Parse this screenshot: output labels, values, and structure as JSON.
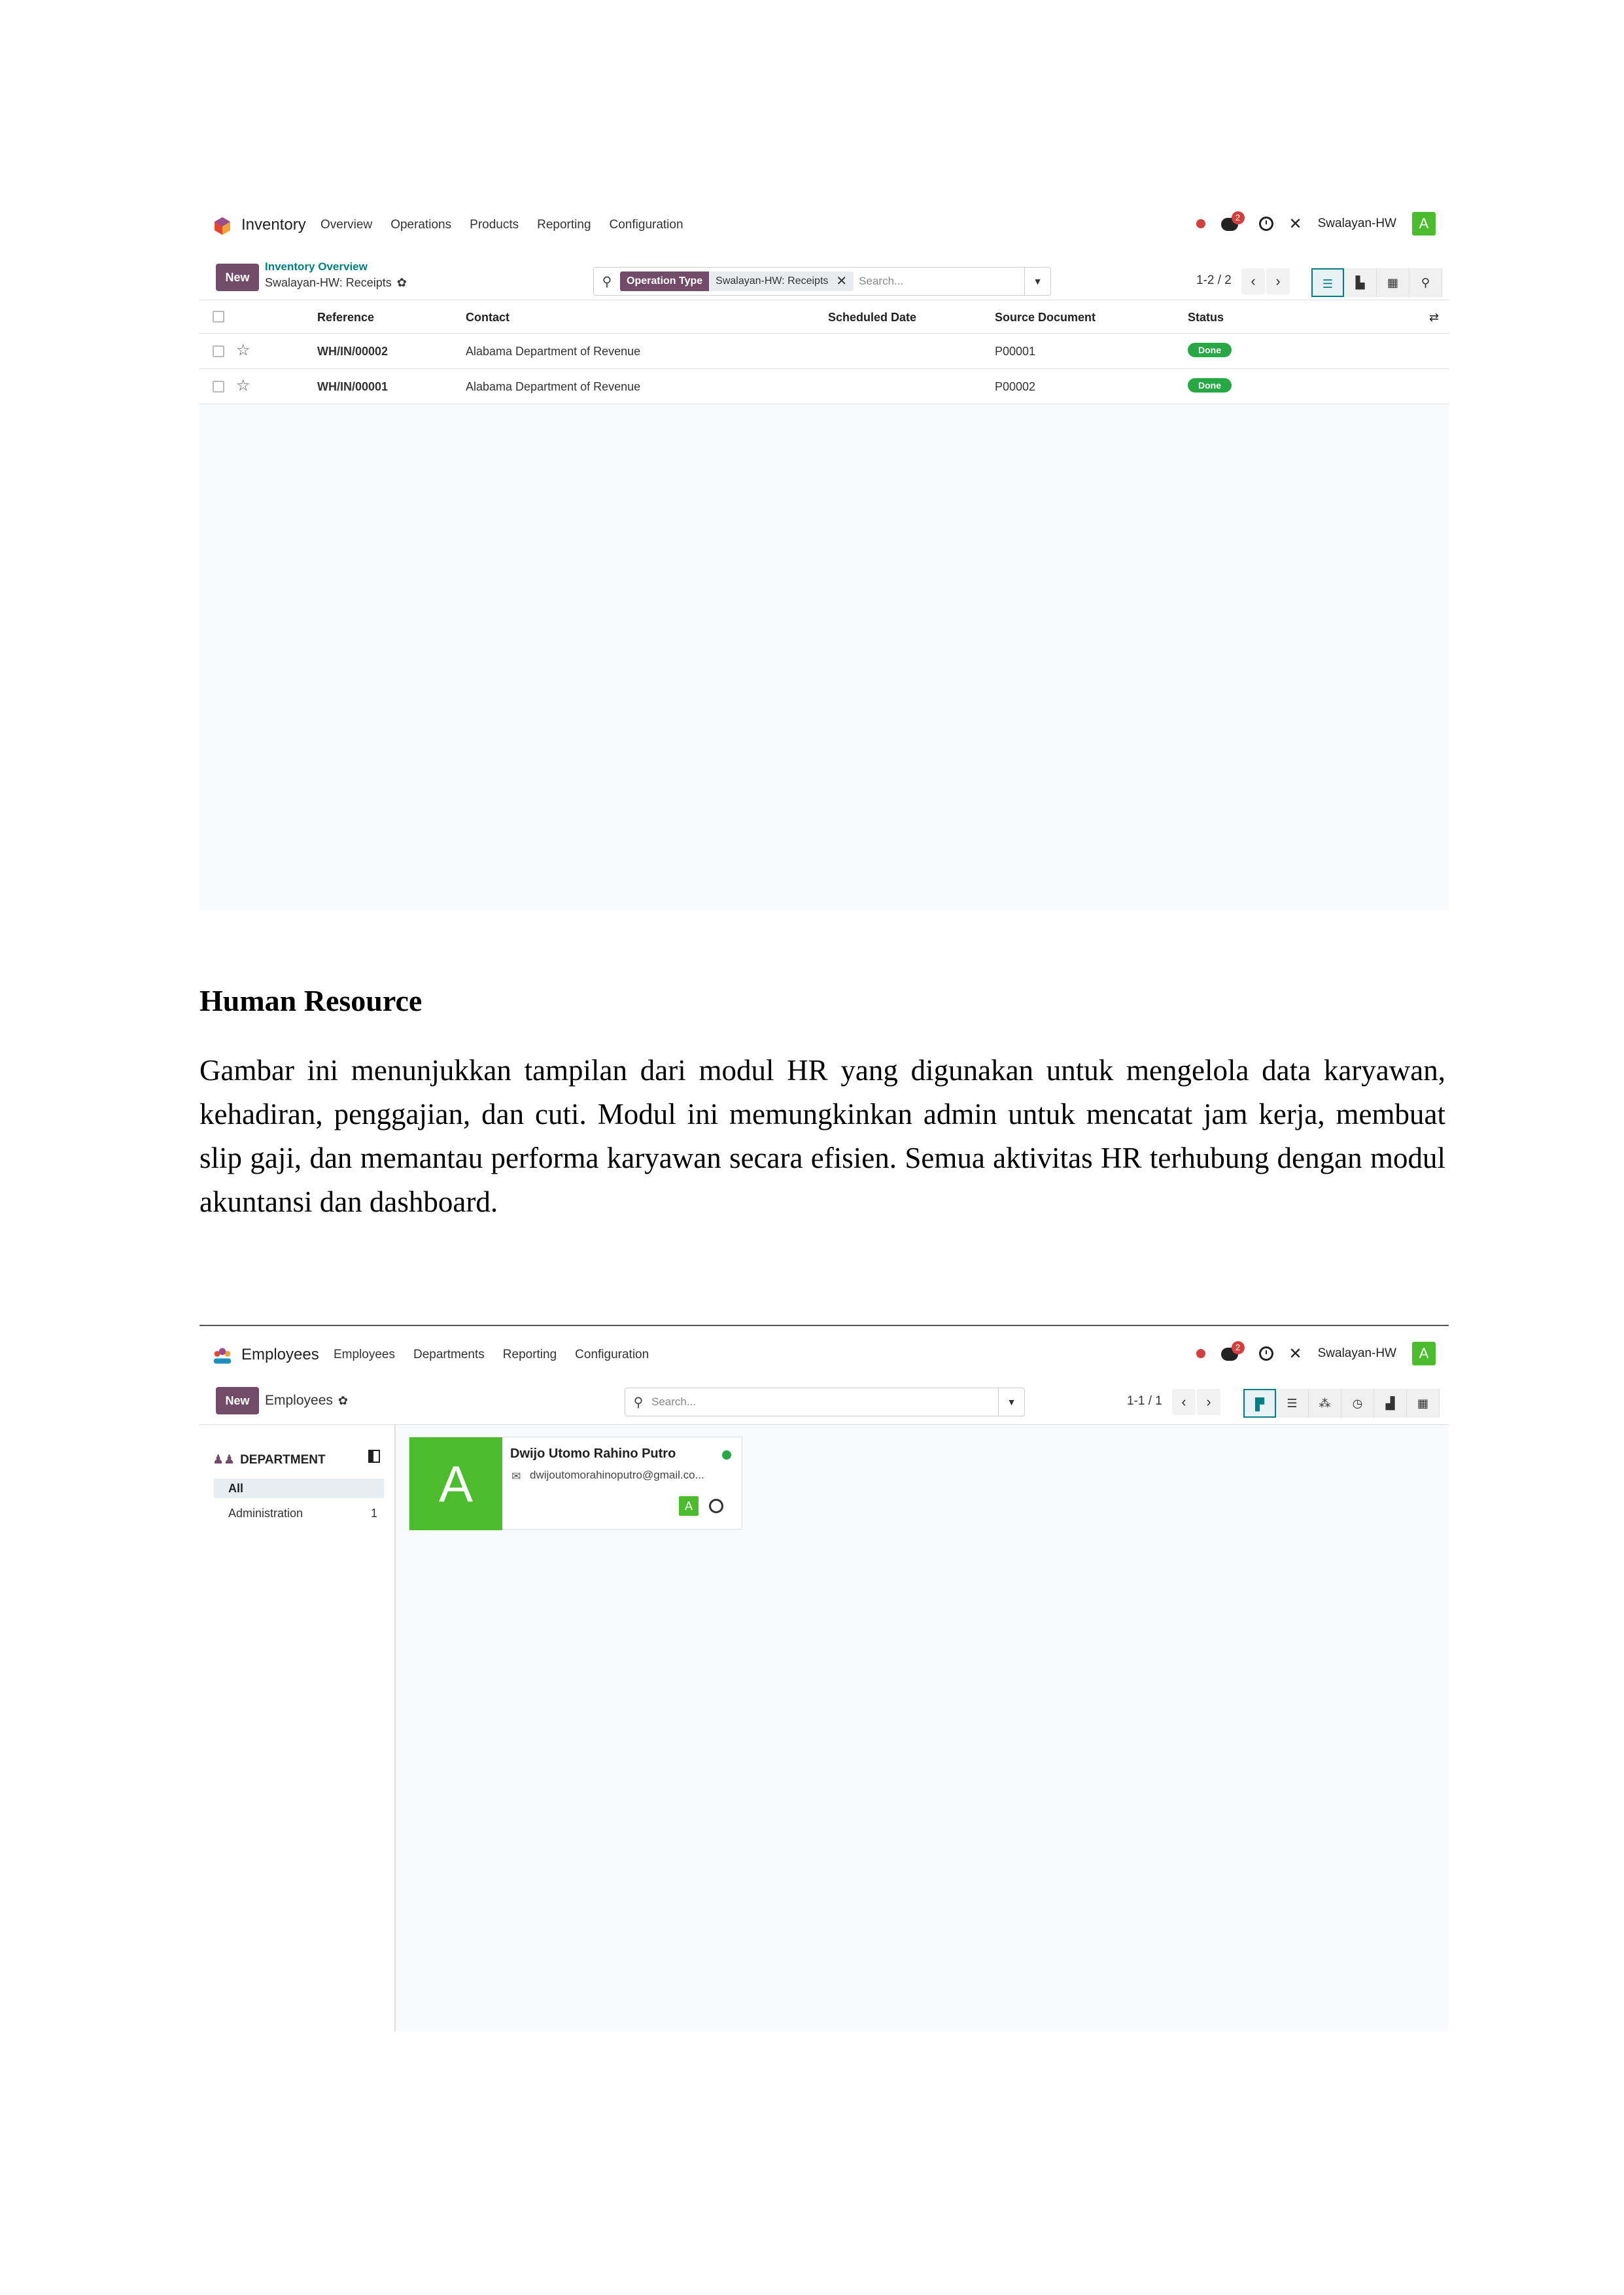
{
  "inventory": {
    "app_name": "Inventory",
    "menu": [
      "Overview",
      "Operations",
      "Products",
      "Reporting",
      "Configuration"
    ],
    "chat_badge": "2",
    "company": "Swalayan-HW",
    "avatar_letter": "A",
    "new_label": "New",
    "breadcrumb_parent": "Inventory Overview",
    "breadcrumb_current": "Swalayan-HW: Receipts",
    "facet_label": "Operation Type",
    "facet_value": "Swalayan-HW: Receipts",
    "search_placeholder": "Search...",
    "pager": "1-2 / 2",
    "columns": [
      "Reference",
      "Contact",
      "Scheduled Date",
      "Source Document",
      "Status"
    ],
    "rows": [
      {
        "reference": "WH/IN/00002",
        "contact": "Alabama Department of Revenue",
        "scheduled_date": "",
        "source": "P00001",
        "status": "Done"
      },
      {
        "reference": "WH/IN/00001",
        "contact": "Alabama Department of Revenue",
        "scheduled_date": "",
        "source": "P00002",
        "status": "Done"
      }
    ]
  },
  "section": {
    "heading": "Human Resource",
    "paragraph": "Gambar ini menunjukkan tampilan dari modul HR yang digunakan untuk mengelola data karyawan, kehadiran, penggajian, dan cuti. Modul ini memungkinkan admin untuk mencatat jam kerja, membuat slip gaji, dan memantau performa karyawan secara efisien. Semua aktivitas HR terhubung dengan modul akuntansi dan dashboard."
  },
  "employees": {
    "app_name": "Employees",
    "menu": [
      "Employees",
      "Departments",
      "Reporting",
      "Configuration"
    ],
    "chat_badge": "2",
    "company": "Swalayan-HW",
    "avatar_letter": "A",
    "new_label": "New",
    "breadcrumb_current": "Employees",
    "search_placeholder": "Search...",
    "pager": "1-1 / 1",
    "side_title": "DEPARTMENT",
    "departments": [
      {
        "name": "All",
        "count": ""
      },
      {
        "name": "Administration",
        "count": "1"
      }
    ],
    "card": {
      "photo_letter": "A",
      "name": "Dwijo Utomo Rahino Putro",
      "email": "dwijoutomorahinoputro@gmail.co...",
      "avatar_letter": "A"
    }
  },
  "colors": {
    "brand": "#714b67",
    "teal": "#017e84",
    "done": "#28a745",
    "avatar": "#4cbb2d"
  }
}
